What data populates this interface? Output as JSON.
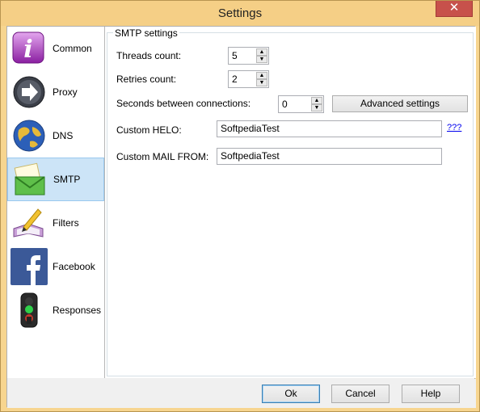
{
  "window": {
    "title": "Settings",
    "close_glyph": "✕"
  },
  "sidebar": {
    "items": [
      {
        "label": "Common",
        "icon": "info-icon"
      },
      {
        "label": "Proxy",
        "icon": "proxy-arrow-icon"
      },
      {
        "label": "DNS",
        "icon": "globe-icon"
      },
      {
        "label": "SMTP",
        "icon": "mail-icon",
        "selected": true
      },
      {
        "label": "Filters",
        "icon": "filters-pen-icon"
      },
      {
        "label": "Facebook",
        "icon": "facebook-icon"
      },
      {
        "label": "Responses",
        "icon": "traffic-light-icon"
      }
    ]
  },
  "smtp": {
    "group_title": "SMTP settings",
    "threads_label": "Threads count:",
    "threads_value": "5",
    "retries_label": "Retries count:",
    "retries_value": "2",
    "seconds_label": "Seconds between connections:",
    "seconds_value": "0",
    "advanced_button": "Advanced settings",
    "helo_label": "Custom HELO:",
    "helo_value": "SoftpediaTest",
    "helo_help_link": "???",
    "mailfrom_label": "Custom MAIL FROM:",
    "mailfrom_value": "SoftpediaTest"
  },
  "footer": {
    "ok": "Ok",
    "cancel": "Cancel",
    "help": "Help"
  },
  "colors": {
    "title_bar": "#f5cf86",
    "close_button": "#c7514b",
    "selection": "#cce4f7",
    "link": "#0000ee"
  }
}
